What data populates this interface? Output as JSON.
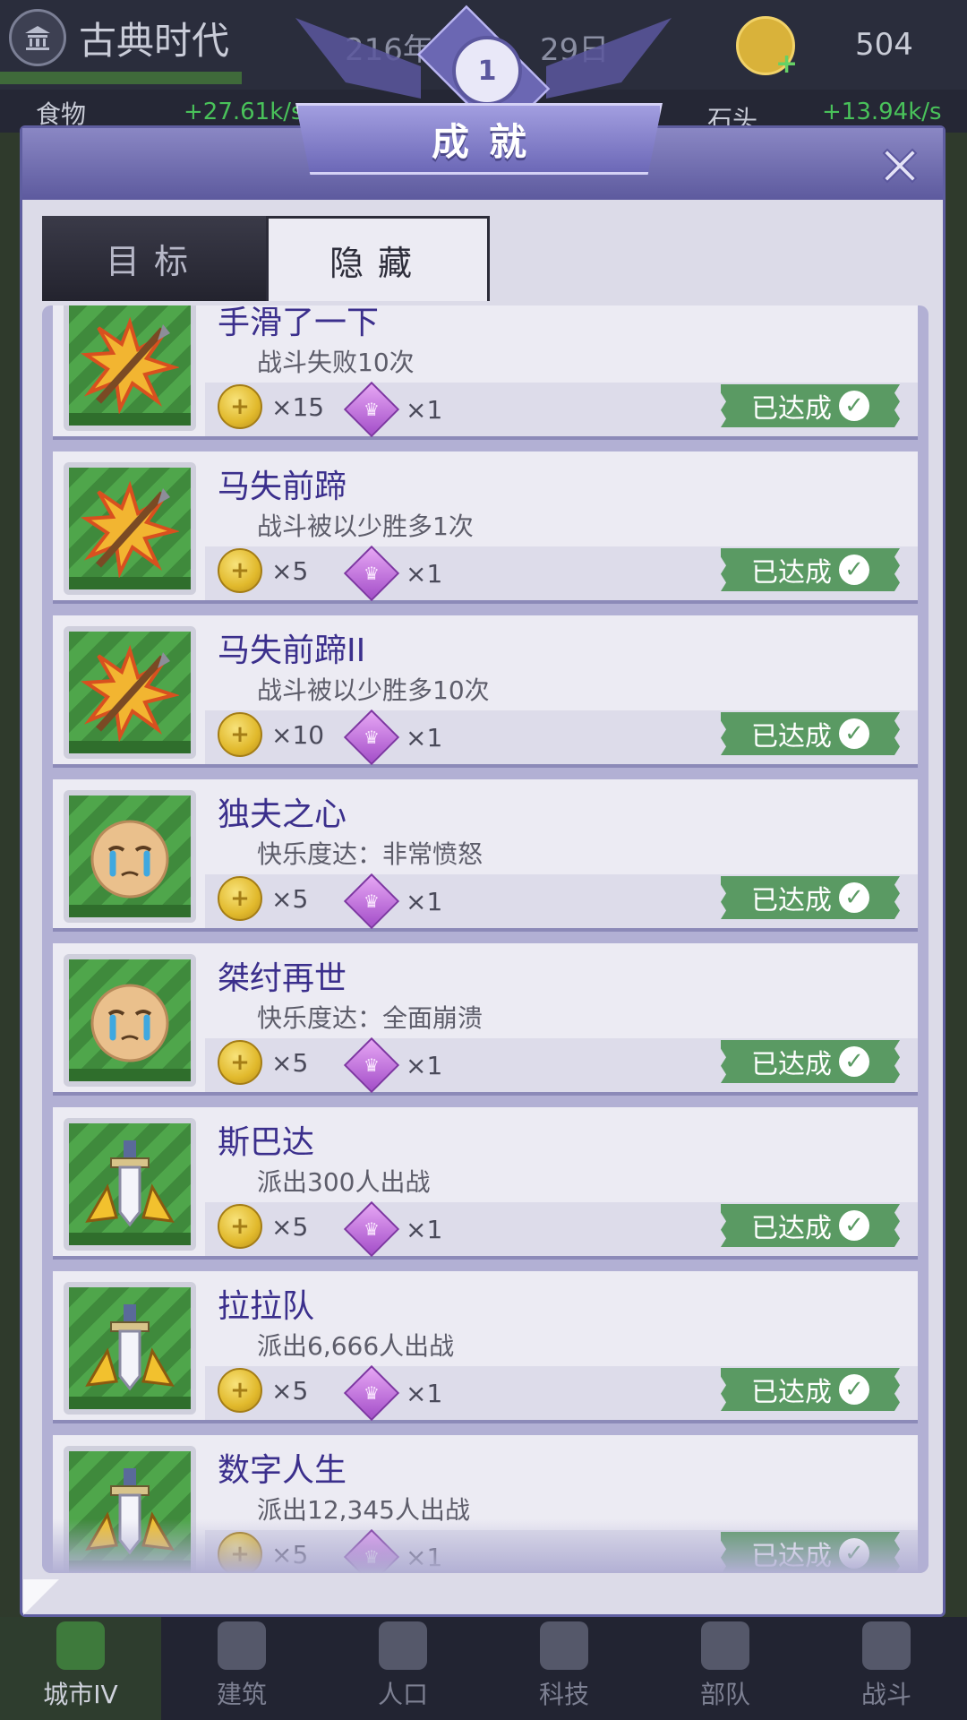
{
  "topbar": {
    "era": "古典时代",
    "year": "216年",
    "day": "29日",
    "coins": "504",
    "food_label": "食物",
    "food_rate": "+27.61k/s",
    "stone_label": "石头",
    "stone_rate": "+13.94k/s"
  },
  "modal": {
    "title": "成就",
    "close_icon": "close-icon",
    "tabs": [
      {
        "label": "目标",
        "active": false
      },
      {
        "label": "隐藏",
        "active": true
      }
    ],
    "achievements": [
      {
        "name": "手滑了一下",
        "desc": "战斗失败10次",
        "coin": "×15",
        "gem": "×1",
        "status": "已达成",
        "icon": "spear-explosion-icon"
      },
      {
        "name": "马失前蹄",
        "desc": "战斗被以少胜多1次",
        "coin": "×5",
        "gem": "×1",
        "status": "已达成",
        "icon": "spear-explosion-icon"
      },
      {
        "name": "马失前蹄II",
        "desc": "战斗被以少胜多10次",
        "coin": "×10",
        "gem": "×1",
        "status": "已达成",
        "icon": "spear-explosion-icon"
      },
      {
        "name": "独夫之心",
        "desc": "快乐度达：非常愤怒",
        "coin": "×5",
        "gem": "×1",
        "status": "已达成",
        "icon": "crying-face-icon"
      },
      {
        "name": "桀纣再世",
        "desc": "快乐度达：全面崩溃",
        "coin": "×5",
        "gem": "×1",
        "status": "已达成",
        "icon": "crying-face-icon"
      },
      {
        "name": "斯巴达",
        "desc": "派出300人出战",
        "coin": "×5",
        "gem": "×1",
        "status": "已达成",
        "icon": "sword-icon"
      },
      {
        "name": "拉拉队",
        "desc": "派出6,666人出战",
        "coin": "×5",
        "gem": "×1",
        "status": "已达成",
        "icon": "sword-icon"
      },
      {
        "name": "数字人生",
        "desc": "派出12,345人出战",
        "coin": "×5",
        "gem": "×1",
        "status": "已达成",
        "icon": "sword-icon"
      }
    ]
  },
  "nav": [
    {
      "label": "城市IV",
      "icon": "castle-icon",
      "active": true
    },
    {
      "label": "建筑",
      "icon": "house-icon",
      "active": false
    },
    {
      "label": "人口",
      "icon": "person-icon",
      "active": false
    },
    {
      "label": "科技",
      "icon": "book-icon",
      "active": false
    },
    {
      "label": "部队",
      "icon": "banner-icon",
      "active": false
    },
    {
      "label": "战斗",
      "icon": "crossed-swords-icon",
      "active": false
    }
  ]
}
